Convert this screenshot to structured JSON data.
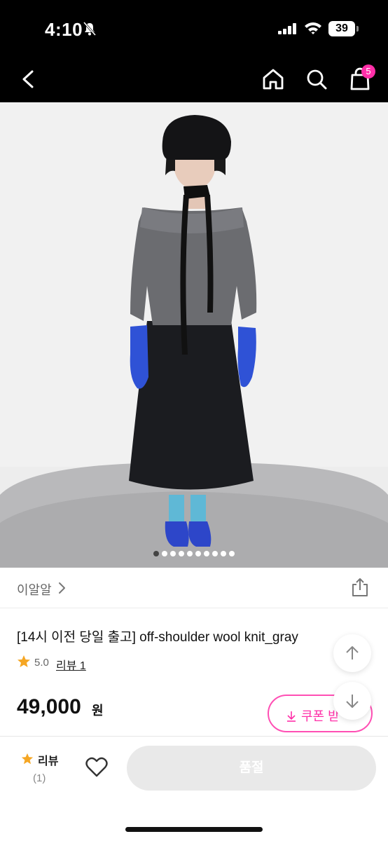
{
  "status_bar": {
    "time": "4:10",
    "battery": "39"
  },
  "nav": {
    "cart_count": "5"
  },
  "gallery": {
    "total": 10,
    "active_index": 0
  },
  "brand": {
    "name": "이알알"
  },
  "product": {
    "title": "[14시 이전 당일 출고] off-shoulder wool knit_gray",
    "rating": "5.0",
    "review_link": "리뷰 1",
    "price": "49,000",
    "price_unit": "원",
    "coupon_label": "쿠폰 받"
  },
  "bottom_bar": {
    "review_label": "리뷰",
    "review_count": "(1)",
    "buy_label": "품절"
  },
  "colors": {
    "accent": "#ff2fa8",
    "star": "#f5a623",
    "disabled": "#e9e9e9"
  }
}
